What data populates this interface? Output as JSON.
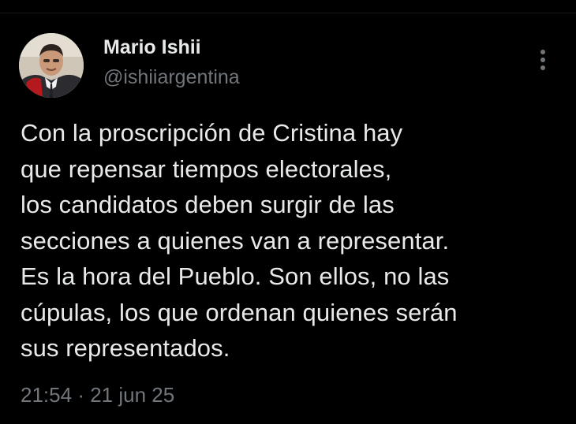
{
  "author": {
    "display_name": "Mario Ishii",
    "handle": "@ishiiargentina",
    "avatar_icon": "profile-photo"
  },
  "menu": {
    "icon": "more-vertical-icon"
  },
  "tweet": {
    "lines": [
      "Con la proscripción de Cristina hay",
      "que repensar tiempos electorales,",
      "los candidatos deben surgir de las",
      "secciones a quienes van a representar.",
      "Es la hora del Pueblo. Son ellos, no las",
      "cúpulas, los que ordenan quienes serán",
      "sus representados."
    ],
    "time": "21:54",
    "separator": "·",
    "date": "21 jun 25"
  },
  "colors": {
    "background": "#000000",
    "primary_text": "#e7e9ea",
    "secondary_text": "#71767b"
  }
}
